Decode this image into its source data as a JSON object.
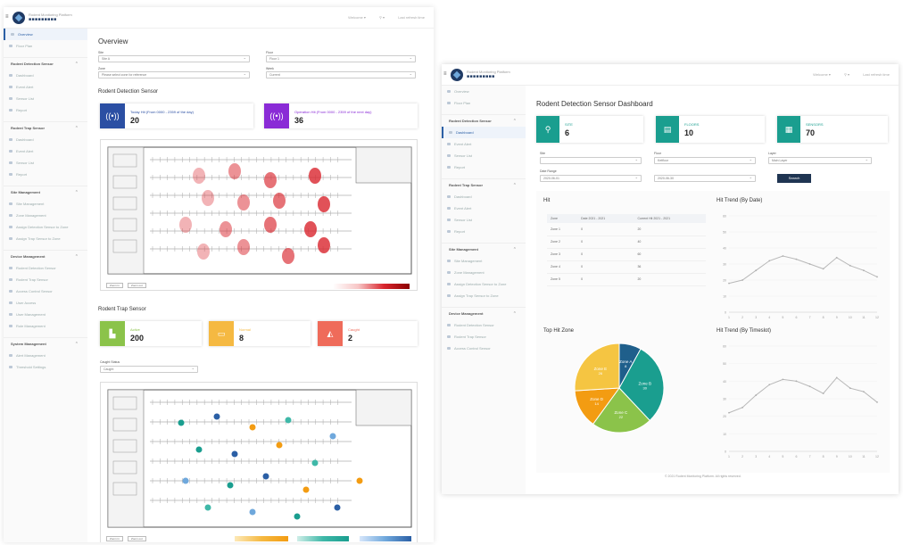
{
  "left": {
    "brand": {
      "title": "Rodent Monitoring Platform",
      "name": "■■■■■■■■■"
    },
    "topright": [
      "Welcome ▾",
      "⚲ ▾",
      "Last refresh time"
    ],
    "sidebar": [
      {
        "type": "item",
        "label": "Overview",
        "active": true
      },
      {
        "type": "item",
        "label": "Floor Plan"
      },
      {
        "type": "group",
        "label": "Rodent Detection Sensor"
      },
      {
        "type": "item",
        "label": "Dashboard"
      },
      {
        "type": "item",
        "label": "Event Alert"
      },
      {
        "type": "item",
        "label": "Sensor List"
      },
      {
        "type": "item",
        "label": "Report"
      },
      {
        "type": "group",
        "label": "Rodent Trap Sensor"
      },
      {
        "type": "item",
        "label": "Dashboard"
      },
      {
        "type": "item",
        "label": "Event Alert"
      },
      {
        "type": "item",
        "label": "Sensor List"
      },
      {
        "type": "item",
        "label": "Report"
      },
      {
        "type": "group",
        "label": "Site Management"
      },
      {
        "type": "item",
        "label": "Site Management"
      },
      {
        "type": "item",
        "label": "Zone Management"
      },
      {
        "type": "item",
        "label": "Assign Detection Sensor to Zone"
      },
      {
        "type": "item",
        "label": "Assign Trap Sensor to Zone"
      },
      {
        "type": "group",
        "label": "Device Management"
      },
      {
        "type": "item",
        "label": "Rodent Detection Sensor"
      },
      {
        "type": "item",
        "label": "Rodent Trap Sensor"
      },
      {
        "type": "item",
        "label": "Access Control Sensor"
      },
      {
        "type": "item",
        "label": "User Access"
      },
      {
        "type": "item",
        "label": "User Management"
      },
      {
        "type": "item",
        "label": "Role Management"
      },
      {
        "type": "group",
        "label": "System Management"
      },
      {
        "type": "item",
        "label": "Alert Management"
      },
      {
        "type": "item",
        "label": "Threshold Settings"
      }
    ],
    "title": "Overview",
    "filters": [
      {
        "label": "Site",
        "value": "Site A"
      },
      {
        "label": "Floor",
        "value": "Floor 1"
      },
      {
        "label": "Zone",
        "value": "Please select zone for reference"
      },
      {
        "label": "Week",
        "value": "Current"
      }
    ],
    "detection_title": "Rodent Detection Sensor",
    "detection_cards": [
      {
        "label": "Today Hit (From 0000 - 2359 of the day)",
        "value": "20",
        "color": "#2b4fa3"
      },
      {
        "label": "Operation Hit (From 0000 - 2359 of the next day)",
        "value": "36",
        "color": "#8a2bd6"
      }
    ],
    "trap_title": "Rodent Trap Sensor",
    "trap_cards": [
      {
        "label": "Active",
        "value": "200",
        "color": "#8bc34a"
      },
      {
        "label": "Normal",
        "value": "8",
        "color": "#f5b942"
      },
      {
        "label": "Caught",
        "value": "2",
        "color": "#ef6b5a"
      }
    ],
    "trap_filter": {
      "label": "Caught Status",
      "value": "Caught"
    },
    "map_buttons": [
      "Zoom in",
      "Zoom out"
    ]
  },
  "right": {
    "brand": {
      "title": "Rodent Monitoring Platform",
      "name": "■■■■■■■■■"
    },
    "topright": [
      "Welcome ▾",
      "⚲ ▾",
      "Last refresh time"
    ],
    "sidebar": [
      {
        "type": "item",
        "label": "Overview"
      },
      {
        "type": "item",
        "label": "Floor Plan"
      },
      {
        "type": "group",
        "label": "Rodent Detection Sensor"
      },
      {
        "type": "item",
        "label": "Dashboard",
        "active": true
      },
      {
        "type": "item",
        "label": "Event Alert"
      },
      {
        "type": "item",
        "label": "Sensor List"
      },
      {
        "type": "item",
        "label": "Report"
      },
      {
        "type": "group",
        "label": "Rodent Trap Sensor"
      },
      {
        "type": "item",
        "label": "Dashboard"
      },
      {
        "type": "item",
        "label": "Event Alert"
      },
      {
        "type": "item",
        "label": "Sensor List"
      },
      {
        "type": "item",
        "label": "Report"
      },
      {
        "type": "group",
        "label": "Site Management"
      },
      {
        "type": "item",
        "label": "Site Management"
      },
      {
        "type": "item",
        "label": "Zone Management"
      },
      {
        "type": "item",
        "label": "Assign Detection Sensor to Zone"
      },
      {
        "type": "item",
        "label": "Assign Trap Sensor to Zone"
      },
      {
        "type": "group",
        "label": "Device Management"
      },
      {
        "type": "item",
        "label": "Rodent Detection Sensor"
      },
      {
        "type": "item",
        "label": "Rodent Trap Sensor"
      },
      {
        "type": "item",
        "label": "Access Control Sensor"
      }
    ],
    "title": "Rodent Detection Sensor Dashboard",
    "stat_cards": [
      {
        "label": "SITE",
        "value": "6",
        "icon": "⚲"
      },
      {
        "label": "FLOORS",
        "value": "10",
        "icon": "▤"
      },
      {
        "label": "SENSORS",
        "value": "70",
        "icon": "▦"
      }
    ],
    "filters": [
      {
        "label": "Site",
        "value": ""
      },
      {
        "label": "Floor",
        "value": "Ketfloor"
      },
      {
        "label": "Layer",
        "value": "Main Layer"
      }
    ],
    "date_range": {
      "label": "Date Range",
      "from": "2020-06-01",
      "to": "2020-06-30"
    },
    "search_label": "Search",
    "hit_title": "Hit",
    "hit_table": {
      "headers": [
        "Zone",
        "Date\n2021 - 2021",
        "Current Hit\n2021 - 2021"
      ],
      "rows": [
        [
          "Zone 1",
          "0",
          "20"
        ],
        [
          "Zone 2",
          "0",
          "40"
        ],
        [
          "Zone 3",
          "0",
          "60"
        ],
        [
          "Zone 4",
          "0",
          "36"
        ],
        [
          "Zone 5",
          "0",
          "20"
        ]
      ]
    },
    "trend_date_title": "Hit Trend (By Date)",
    "trend_slot_title": "Hit Trend (By Timeslot)",
    "pie_title": "Top Hit Zone",
    "footnote": "© 2021 Rodent Monitoring Platform. All rights reserved."
  },
  "chart_data": [
    {
      "type": "pie",
      "title": "Top Hit Zone",
      "categories": [
        "Zone A",
        "Zone B",
        "Zone C",
        "Zone D",
        "Zone E"
      ],
      "values": [
        8,
        30,
        22,
        14,
        26
      ],
      "colors": [
        "#1f5f8b",
        "#1a9e8f",
        "#8bc34a",
        "#f39c12",
        "#f5c542"
      ]
    },
    {
      "type": "line",
      "title": "Hit Trend (By Date)",
      "x": [
        1,
        2,
        3,
        4,
        5,
        6,
        7,
        8,
        9,
        10,
        11,
        12
      ],
      "series": [
        {
          "values": [
            18,
            20,
            26,
            32,
            35,
            33,
            30,
            27,
            34,
            29,
            26,
            22
          ]
        }
      ],
      "ylim": [
        0,
        60
      ]
    },
    {
      "type": "line",
      "title": "Hit Trend (By Timeslot)",
      "x": [
        1,
        2,
        3,
        4,
        5,
        6,
        7,
        8,
        9,
        10,
        11,
        12
      ],
      "series": [
        {
          "values": [
            22,
            25,
            32,
            38,
            41,
            40,
            37,
            33,
            42,
            36,
            34,
            28
          ]
        }
      ],
      "ylim": [
        0,
        60
      ]
    }
  ]
}
